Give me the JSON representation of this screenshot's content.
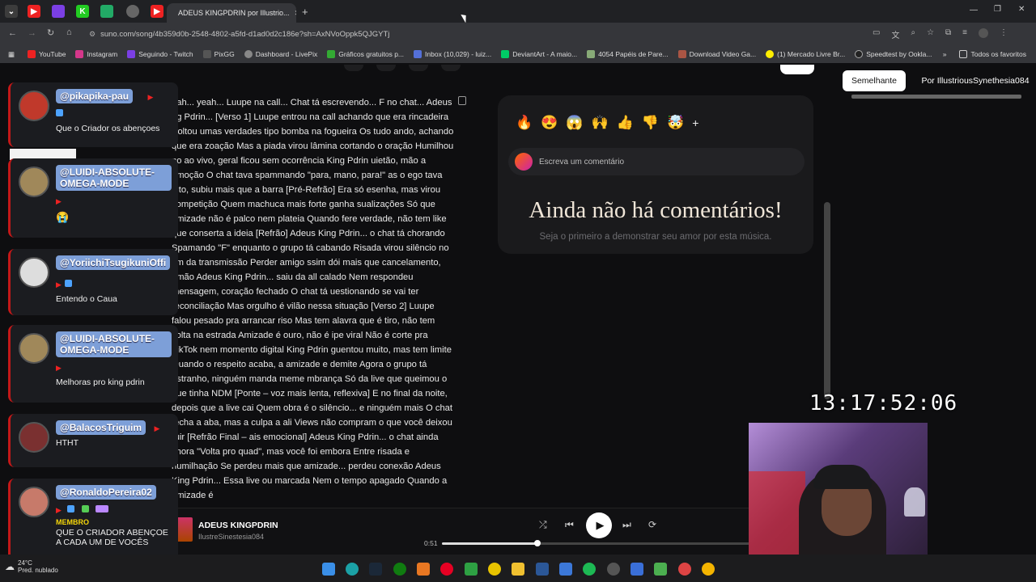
{
  "browser": {
    "active_tab_title": "ADEUS KINGPDRIN por Illustrio...",
    "url": "suno.com/song/4b359d0b-2548-4802-a5fd-d1ad0d2c186e?sh=AxNVoOppk5QJGYTj",
    "bookmarks": [
      "YouTube",
      "Instagram",
      "Seguindo - Twitch",
      "PixGG",
      "Dashboard - LivePix",
      "Gráficos gratuitos p...",
      "Inbox (10,029) - luiz...",
      "DeviantArt - A maio...",
      "4054 Papéis de Pare...",
      "Download Video Ga...",
      "(1) Mercado Livre Br...",
      "Speedtest by Ookla..."
    ],
    "all_favorites": "Todos os favoritos"
  },
  "lyrics": "eah... yeah... Luupe na call... Chat tá escrevendo... F no chat... Adeus ng Pdrin... [Verso 1] Luupe entrou na call achando que era rincadeira Soltou umas verdades tipo bomba na fogueira Os tudo ando, achando que era zoação Mas a piada virou lâmina cortando o oração Humilhou no ao vivo, geral ficou sem ocorrência King Pdrin uietão, mão a emoção O chat tava spammando \"para, mano, para!\" as o ego tava alto, subiu mais que a barra [Pré-Refrão] Era só esenha, mas virou competição Quem machuca mais forte ganha sualizações Só que amizade não é palco nem plateia Quando fere verdade, não tem like que conserta a ideia [Refrão] Adeus King Pdrin... o chat tá chorando Spamando \"F\" enquanto o grupo tá cabando Risada virou silêncio no fim da transmissão Perder amigo ssim dói mais que cancelamento, irmão Adeus King Pdrin... saiu da all calado Nem respondeu mensagem, coração fechado O chat tá uestionando se vai ter reconciliação Mas orgulho é vilão nessa situação [Verso 2] Luupe falou pesado pra arrancar riso Mas tem alavra que é tiro, não tem volta na estrada Amizade é ouro, não é ipe viral Não é corte pra TikTok nem momento digital King Pdrin guentou muito, mas tem limite Quando o respeito acaba, a amizade e demite Agora o grupo tá estranho, ninguém manda meme mbrança Só da live que queimou o que tinha NDM [Ponte – voz mais lenta, reflexiva] E no final da noite, depois que a live cai Quem obra é o silêncio... e ninguém mais O chat fecha a aba, mas a culpa a ali Views não compram o que você deixou ruir [Refrão Final – ais emocional] Adeus King Pdrin... o chat ainda chora \"Volta pro quad\", mas você foi embora Entre risada e humilhação Se perdeu mais que amizade... perdeu conexão Adeus King Pdrin... Essa live ou marcada Nem o tempo apagado Quando a amizade é",
  "comments": {
    "reactions": [
      "🔥",
      "😍",
      "😱",
      "🙌",
      "👍",
      "👎",
      "🤯"
    ],
    "add_reaction": "+",
    "placeholder": "Escreva um comentário",
    "empty_title": "Ainda não há comentários!",
    "empty_subtitle": "Seja o primeiro a demonstrar seu amor por esta música."
  },
  "right_panel": {
    "tab_similar": "Semelhante",
    "tab_by": "Por IllustriousSynethesia084"
  },
  "overlay_timer": "13:17:52:06",
  "player": {
    "title": "ADEUS KINGPDRIN",
    "artist": "IlustreSinestesia084",
    "elapsed": "0:51",
    "progress": 0.31
  },
  "chat": [
    {
      "user": "@pikapika-pau",
      "message": "Que o Criador os abençoes",
      "avatar_color": "#c0392b"
    },
    {
      "user": "@LUIDI-ABSOLUTE-OMEGA-MODE",
      "message": "😭",
      "avatar_color": "#a0885a"
    },
    {
      "user": "@YoriichiTsugikuniOffi",
      "message": "Entendo o Caua",
      "avatar_color": "#dddddd"
    },
    {
      "user": "@LUIDI-ABSOLUTE-OMEGA-MODE",
      "message": "Melhoras pro king pdrin",
      "avatar_color": "#a0885a"
    },
    {
      "user": "@BalacosTriguim",
      "message": "HTHT",
      "avatar_color": "#7a3030"
    },
    {
      "user": "@RonaldoPereira02",
      "badge_text": "MEMBRO",
      "message": "QUE O CRIADOR ABENÇOE A CADA UM DE VOCÊS",
      "avatar_color": "#c77a6a"
    }
  ],
  "weather": {
    "temp": "24°C",
    "desc": "Pred. nublado"
  }
}
